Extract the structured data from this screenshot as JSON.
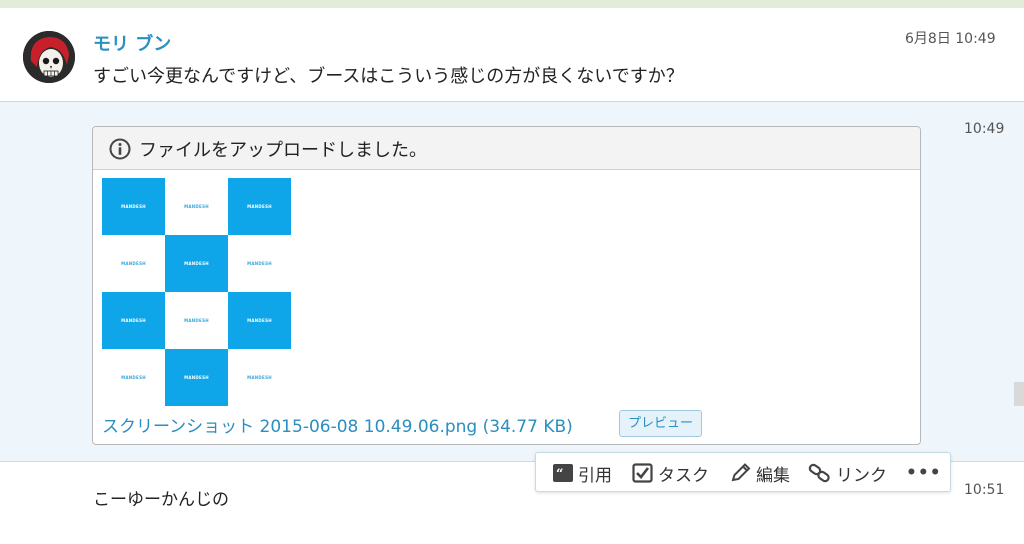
{
  "messages": [
    {
      "sender": "モリ ブン",
      "text": "すごい今更なんですけど、ブースはこういう感じの方が良くないですか？",
      "timestamp": "6月8日 10:49"
    },
    {
      "timestamp": "10:49",
      "file": {
        "header": "ファイルをアップロードしました。",
        "filename": "スクリーンショット 2015-06-08 10.49.06.png (34.77 KB)",
        "preview_label": "プレビュー",
        "thumbnail_logo": "MANDESH"
      }
    },
    {
      "text": "こーゆーかんじの",
      "timestamp": "10:51"
    }
  ],
  "action_bar": {
    "quote": "引用",
    "task": "タスク",
    "edit": "編集",
    "link": "リンク",
    "more": "•••"
  },
  "colors": {
    "accent": "#2a8fc1",
    "tile_blue": "#0ea5e9",
    "row_highlight": "#eef5fb"
  }
}
